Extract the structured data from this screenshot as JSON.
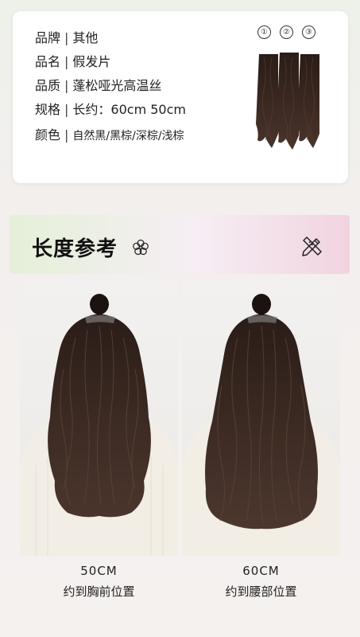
{
  "specs": [
    {
      "label": "品牌",
      "value": "其他"
    },
    {
      "label": "品名",
      "value": "假发片"
    },
    {
      "label": "品质",
      "value": "蓬松哑光高温丝"
    },
    {
      "label": "规格",
      "value": "长约：60cm 50cm"
    },
    {
      "label": "颜色",
      "value": "自然黑/黑棕/深棕/浅棕"
    }
  ],
  "swatch_numbers": [
    "①",
    "②",
    "③"
  ],
  "section": {
    "title": "长度参考"
  },
  "lengths": [
    {
      "length": "50CM",
      "position": "约到胸前位置"
    },
    {
      "length": "60CM",
      "position": "约到腰部位置"
    }
  ],
  "colors": {
    "hair": "#3a2a24",
    "hair_dark": "#241813",
    "sweater": "#f3efe6"
  }
}
